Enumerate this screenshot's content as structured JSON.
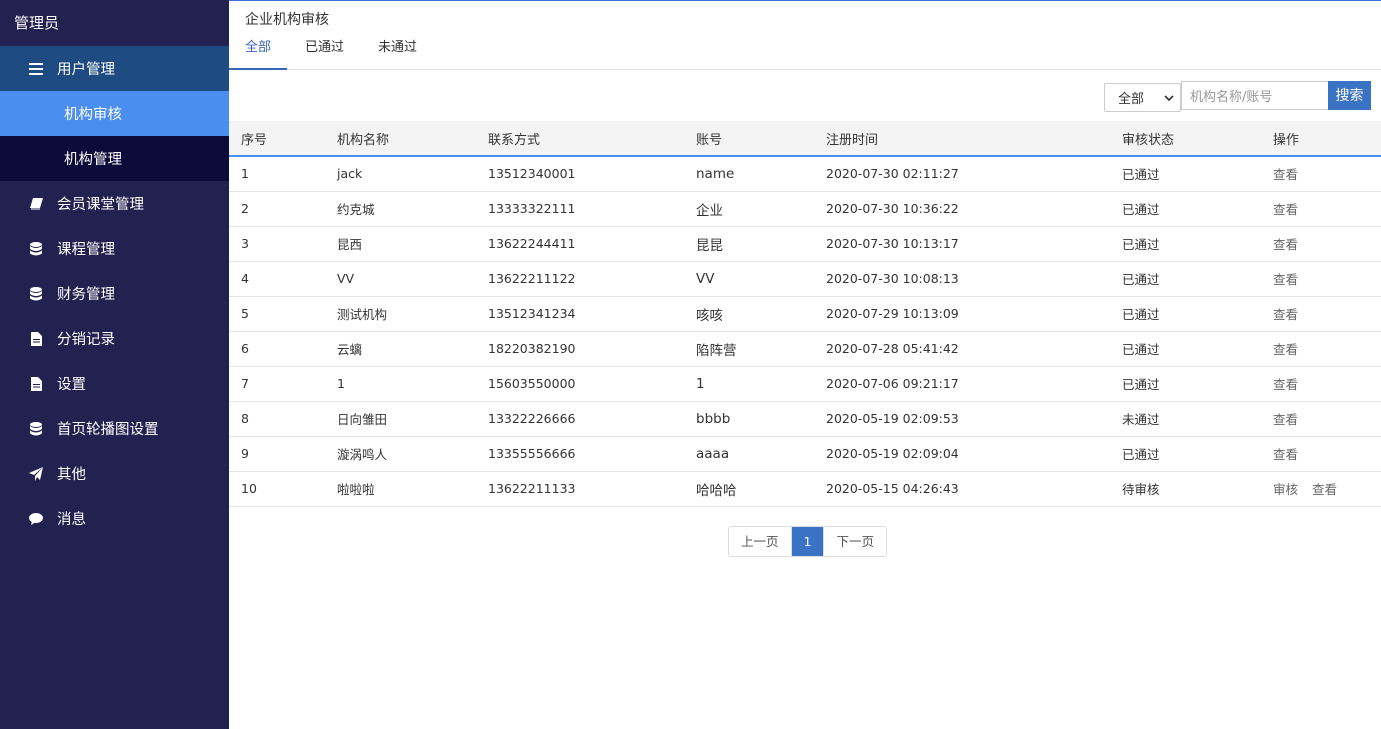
{
  "sidebar": {
    "header": "管理员",
    "menu": [
      {
        "label": "用户管理",
        "icon": "list-icon",
        "open": true,
        "children": [
          {
            "label": "机构审核",
            "active": true
          },
          {
            "label": "机构管理",
            "active": false
          }
        ]
      },
      {
        "label": "会员课堂管理",
        "icon": "book-icon"
      },
      {
        "label": "课程管理",
        "icon": "database-icon"
      },
      {
        "label": "财务管理",
        "icon": "database-icon"
      },
      {
        "label": "分销记录",
        "icon": "file-icon"
      },
      {
        "label": "设置",
        "icon": "file-icon"
      },
      {
        "label": "首页轮播图设置",
        "icon": "database-icon"
      },
      {
        "label": "其他",
        "icon": "send-icon"
      },
      {
        "label": "消息",
        "icon": "comment-icon"
      }
    ]
  },
  "main": {
    "title": "企业机构审核",
    "tabs": [
      {
        "label": "全部",
        "active": true
      },
      {
        "label": "已通过",
        "active": false
      },
      {
        "label": "未通过",
        "active": false
      }
    ],
    "filter": {
      "select_value": "全部",
      "search_placeholder": "机构名称/账号",
      "search_button": "搜索"
    },
    "table": {
      "headers": [
        "序号",
        "机构名称",
        "联系方式",
        "账号",
        "注册时间",
        "审核状态",
        "操作"
      ],
      "rows": [
        {
          "no": "1",
          "name": "jack",
          "phone": "13512340001",
          "account": "name",
          "time": "2020-07-30 02:11:27",
          "status": "已通过",
          "ops": [
            "查看"
          ]
        },
        {
          "no": "2",
          "name": "约克城",
          "phone": "13333322111",
          "account": "企业",
          "time": "2020-07-30 10:36:22",
          "status": "已通过",
          "ops": [
            "查看"
          ]
        },
        {
          "no": "3",
          "name": "昆西",
          "phone": "13622244411",
          "account": "昆昆",
          "time": "2020-07-30 10:13:17",
          "status": "已通过",
          "ops": [
            "查看"
          ]
        },
        {
          "no": "4",
          "name": "VV",
          "phone": "13622211122",
          "account": "VV",
          "time": "2020-07-30 10:08:13",
          "status": "已通过",
          "ops": [
            "查看"
          ]
        },
        {
          "no": "5",
          "name": "测试机构",
          "phone": "13512341234",
          "account": "咳咳",
          "time": "2020-07-29 10:13:09",
          "status": "已通过",
          "ops": [
            "查看"
          ]
        },
        {
          "no": "6",
          "name": "云螭",
          "phone": "18220382190",
          "account": "陷阵营",
          "time": "2020-07-28 05:41:42",
          "status": "已通过",
          "ops": [
            "查看"
          ]
        },
        {
          "no": "7",
          "name": "1",
          "phone": "15603550000",
          "account": "1",
          "time": "2020-07-06 09:21:17",
          "status": "已通过",
          "ops": [
            "查看"
          ]
        },
        {
          "no": "8",
          "name": "日向雏田",
          "phone": "13322226666",
          "account": "bbbb",
          "time": "2020-05-19 02:09:53",
          "status": "未通过",
          "ops": [
            "查看"
          ]
        },
        {
          "no": "9",
          "name": "漩涡鸣人",
          "phone": "13355556666",
          "account": "aaaa",
          "time": "2020-05-19 02:09:04",
          "status": "已通过",
          "ops": [
            "查看"
          ]
        },
        {
          "no": "10",
          "name": "啦啦啦",
          "phone": "13622211133",
          "account": "哈哈哈",
          "time": "2020-05-15 04:26:43",
          "status": "待审核",
          "ops": [
            "审核",
            "查看"
          ]
        }
      ]
    },
    "pagination": {
      "prev": "上一页",
      "current": "1",
      "next": "下一页"
    }
  }
}
